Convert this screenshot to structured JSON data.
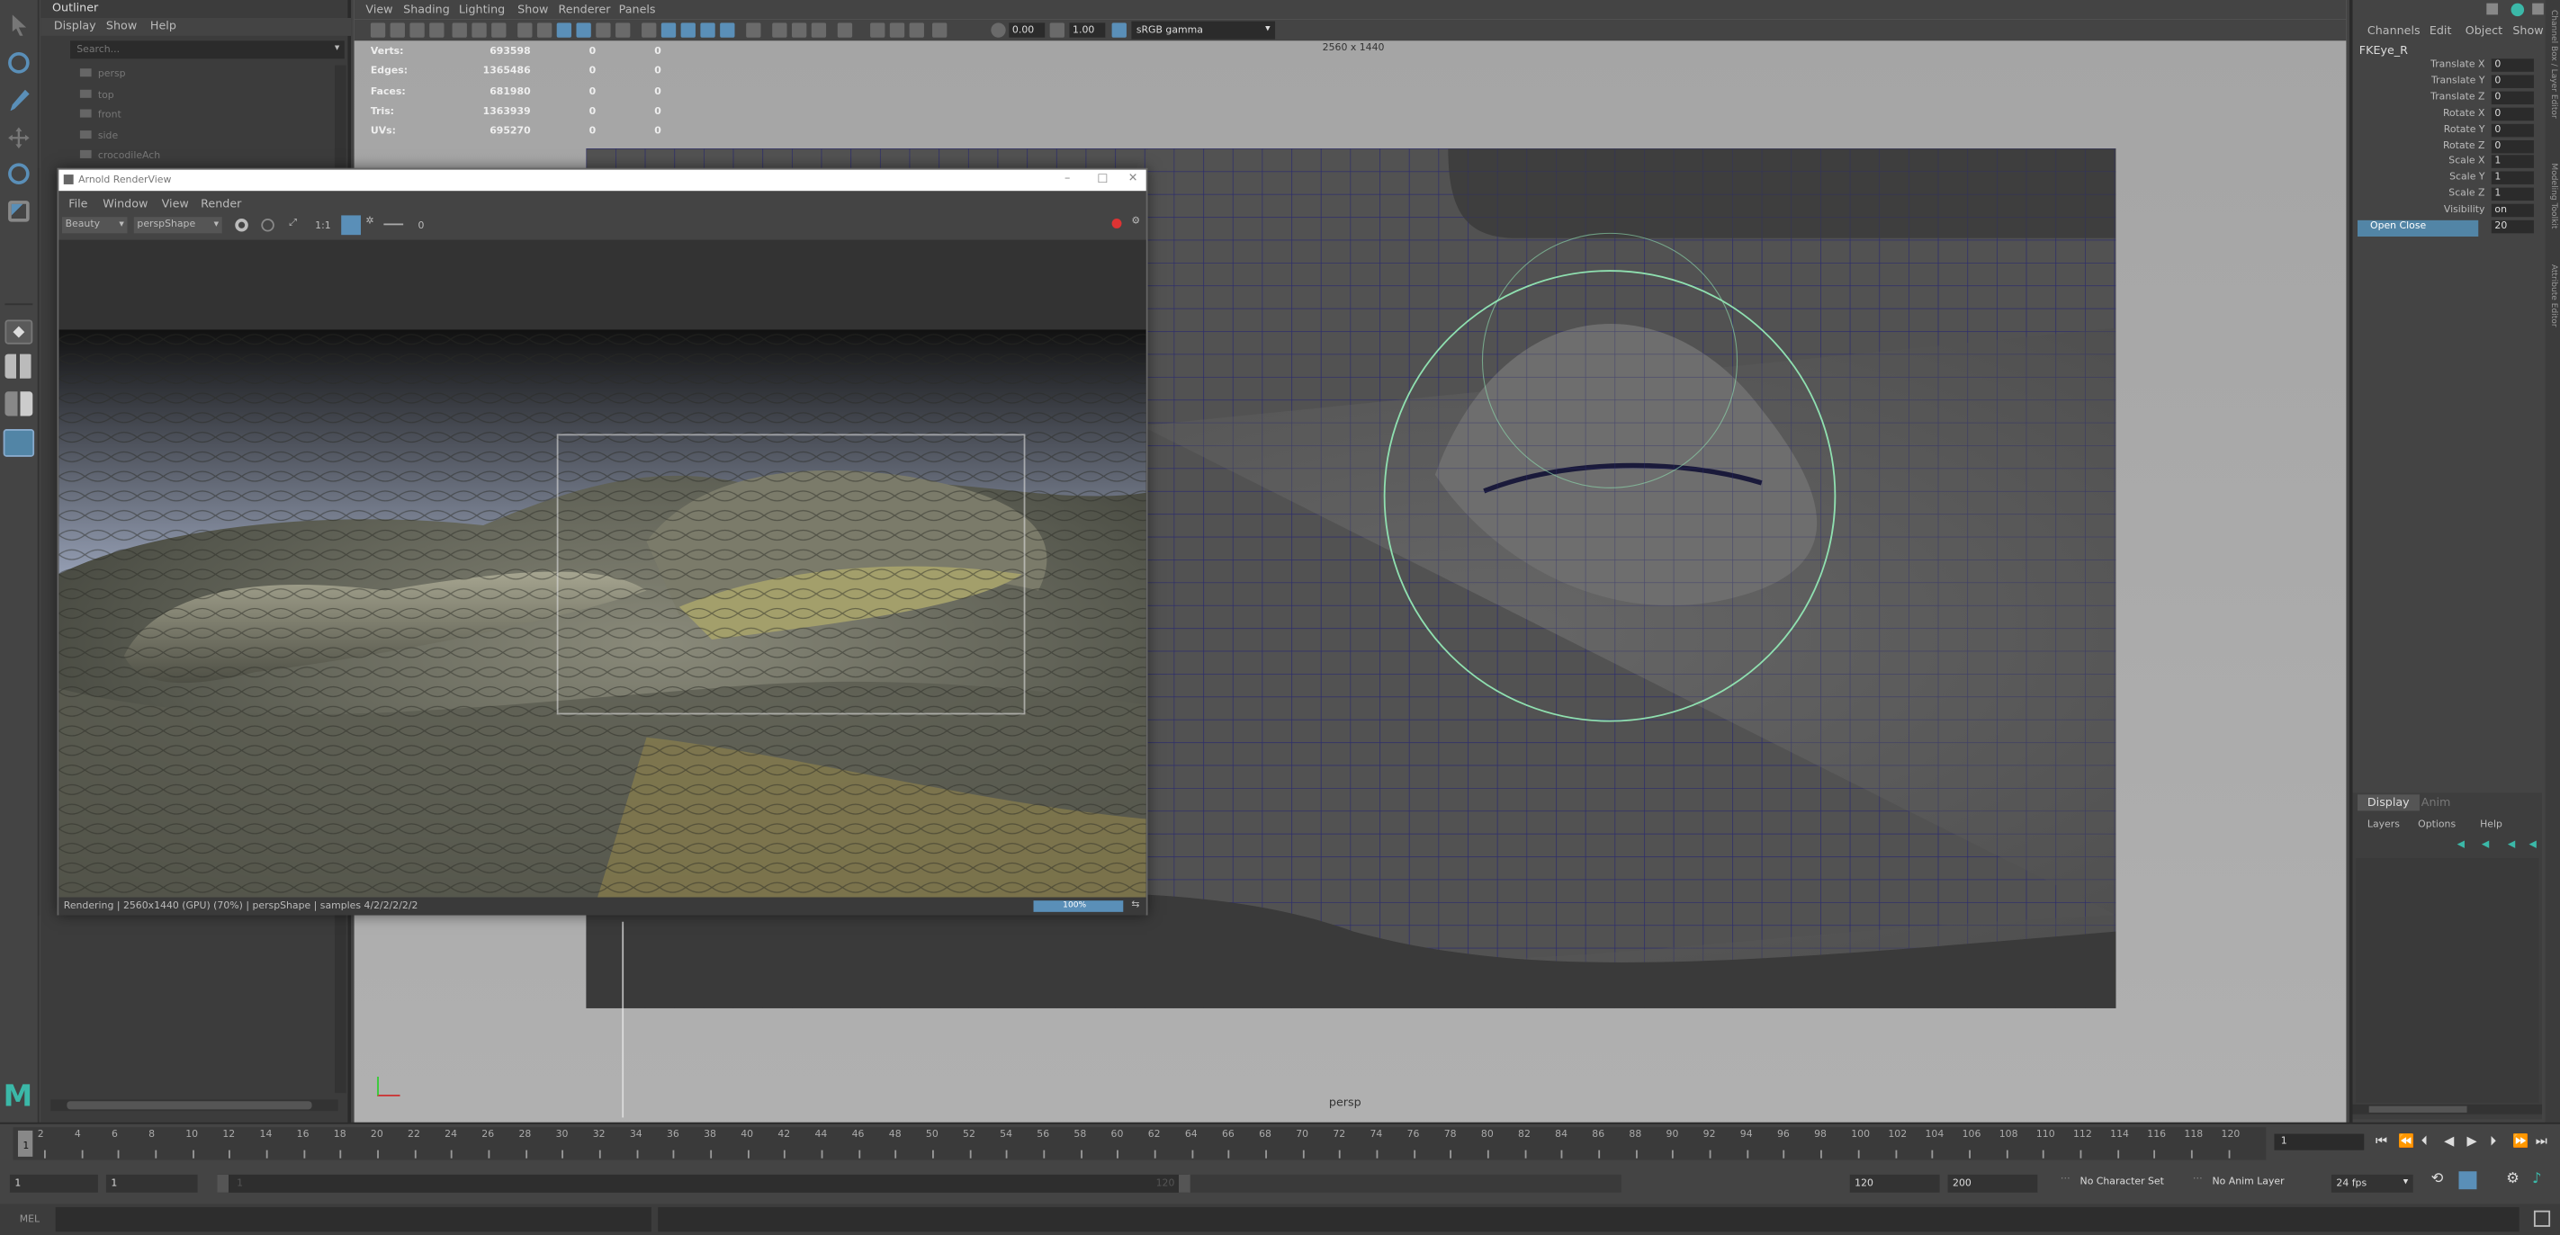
{
  "outliner": {
    "tab": "Outliner",
    "menus": [
      "Display",
      "Show",
      "Help"
    ],
    "search_placeholder": "Search...",
    "items": [
      "persp",
      "top",
      "front",
      "side",
      "crocodileAch"
    ]
  },
  "viewport": {
    "menus": [
      "View",
      "Shading",
      "Lighting",
      "Show",
      "Renderer",
      "Panels"
    ],
    "exposure": "0.00",
    "gamma": "1.00",
    "colorspace": "sRGB gamma",
    "resolution_label": "2560 x 1440",
    "camera_label": "persp",
    "hud": [
      {
        "label": "Verts:",
        "values": [
          "693598",
          "0",
          "0"
        ]
      },
      {
        "label": "Edges:",
        "values": [
          "1365486",
          "0",
          "0"
        ]
      },
      {
        "label": "Faces:",
        "values": [
          "681980",
          "0",
          "0"
        ]
      },
      {
        "label": "Tris:",
        "values": [
          "1363939",
          "0",
          "0"
        ]
      },
      {
        "label": "UVs:",
        "values": [
          "695270",
          "0",
          "0"
        ]
      }
    ]
  },
  "render_view": {
    "title": "Arnold RenderView",
    "menus": [
      "File",
      "Window",
      "View",
      "Render"
    ],
    "aov": "Beauty",
    "camera": "perspShape",
    "ratio": "1:1",
    "exposure_value": "0",
    "status": "Rendering | 2560x1440 (GPU) (70%) | perspShape | samples 4/2/2/2/2/2",
    "progress_label": "100%",
    "progress": 1.0
  },
  "channel_box": {
    "menus": [
      "Channels",
      "Edit",
      "Object",
      "Show"
    ],
    "object": "FKEye_R",
    "channels": [
      {
        "name": "Translate X",
        "value": "0"
      },
      {
        "name": "Translate Y",
        "value": "0"
      },
      {
        "name": "Translate Z",
        "value": "0"
      },
      {
        "name": "Rotate X",
        "value": "0"
      },
      {
        "name": "Rotate Y",
        "value": "0"
      },
      {
        "name": "Rotate Z",
        "value": "0"
      },
      {
        "name": "Scale X",
        "value": "1"
      },
      {
        "name": "Scale Y",
        "value": "1"
      },
      {
        "name": "Scale Z",
        "value": "1"
      },
      {
        "name": "Visibility",
        "value": "on"
      },
      {
        "name": "Open Close",
        "value": "20"
      }
    ],
    "side_tabs": [
      "Channel Box / Layer Editor",
      "Modeling Toolkit",
      "Attribute Editor"
    ]
  },
  "layer_editor": {
    "tabs": [
      "Display",
      "Anim"
    ],
    "menus": [
      "Layers",
      "Options",
      "Help"
    ]
  },
  "timeline": {
    "ticks": [
      "2",
      "4",
      "6",
      "8",
      "10",
      "12",
      "14",
      "16",
      "18",
      "20",
      "22",
      "24",
      "26",
      "28",
      "30",
      "32",
      "34",
      "36",
      "38",
      "40",
      "42",
      "44",
      "46",
      "48",
      "50",
      "52",
      "54",
      "56",
      "58",
      "60",
      "62",
      "64",
      "66",
      "68",
      "70",
      "72",
      "74",
      "76",
      "78",
      "80",
      "82",
      "84",
      "86",
      "88",
      "90",
      "92",
      "94",
      "96",
      "98",
      "100",
      "102",
      "104",
      "106",
      "108",
      "110",
      "112",
      "114",
      "116",
      "118",
      "120"
    ],
    "current_frame": "1",
    "current_frame_field": "1"
  },
  "range_slider": {
    "start": "1",
    "range_start": "1",
    "range_label_start": "1",
    "range_label_end": "120",
    "range_end": "120",
    "end": "200",
    "character_set": "No Character Set",
    "anim_layer": "No Anim Layer",
    "fps": "24 fps"
  },
  "command_line": {
    "mode": "MEL"
  },
  "colors": {
    "accent": "#5a8fb8",
    "selection": "#5285a6",
    "manipulator": "#8fe0b0",
    "wire": "#2a2a6e"
  }
}
